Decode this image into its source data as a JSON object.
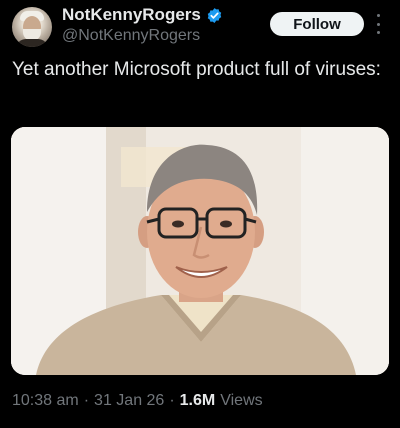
{
  "author": {
    "display_name": "NotKennyRogers",
    "handle": "@NotKennyRogers",
    "verified": true
  },
  "follow_label": "Follow",
  "tweet": {
    "text": "Yet another Microsoft product full of viruses:",
    "media_alt": "Smiling man with glasses wearing a beige sweater"
  },
  "meta": {
    "time": "10:38 am",
    "separator1": "·",
    "date": "31 Jan 26",
    "separator2": "·",
    "views_count": "1.6M",
    "views_label": "Views"
  },
  "colors": {
    "background": "#000000",
    "text": "#e7e9ea",
    "muted": "#71767b",
    "verified": "#1d9bf0",
    "follow_bg": "#eff3f4"
  }
}
